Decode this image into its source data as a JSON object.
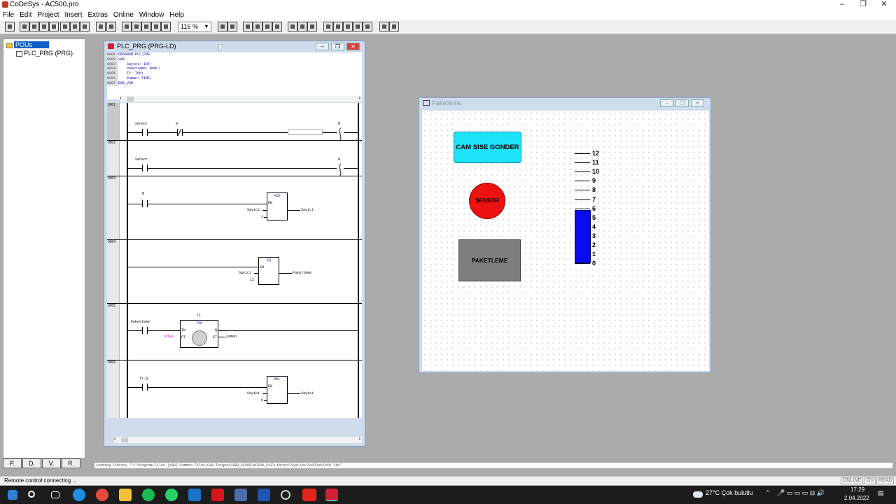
{
  "app": {
    "title": "CoDeSys - AC500.pro",
    "window_controls": [
      "–",
      "❐",
      "✕"
    ]
  },
  "menu": [
    "File",
    "Edit",
    "Project",
    "Insert",
    "Extras",
    "Online",
    "Window",
    "Help"
  ],
  "toolbar": {
    "zoom": "116 %"
  },
  "tree": {
    "root": "POUs",
    "child": "PLC_PRG (PRG)"
  },
  "left_tabs": [
    "P.",
    "D.",
    "V.",
    "R."
  ],
  "editor": {
    "title": "PLC_PRG (PRG-LD)",
    "declaration": [
      {
        "ln": "0001",
        "text": "PROGRAM PLC_PRG"
      },
      {
        "ln": "0002",
        "text": "VAR"
      },
      {
        "ln": "0003",
        "text": "    Sayici: INT;"
      },
      {
        "ln": "0004",
        "text": "    Paketleme: BOOL;"
      },
      {
        "ln": "0005",
        "text": "    T1: TON;"
      },
      {
        "ln": "0006",
        "text": "    Zaman: TIME;"
      },
      {
        "ln": "0007",
        "text": "END_VAR"
      }
    ],
    "rungs": {
      "r1": {
        "num": "0001",
        "c1": "Sensor",
        "c2": "N",
        "coil": "M"
      },
      "r2": {
        "num": "0002",
        "c1": "Sensor",
        "coil": "N"
      },
      "r3": {
        "num": "0003",
        "c1": "M",
        "fb": "ADD",
        "en": "EN",
        "in1": "Sayici",
        "in2": "1",
        "out": "Sayici"
      },
      "r4": {
        "num": "0004",
        "fb": "EQ",
        "en": "EN",
        "in1": "Sayici",
        "in2": "12",
        "out": "Paketleme"
      },
      "r5": {
        "num": "0005",
        "c1": "Paketleme",
        "inst": "T1",
        "fb": "TON",
        "in": "IN",
        "pt": "PT",
        "q": "Q",
        "et": "ET",
        "pt_val": "T#10s",
        "out": "Zaman"
      },
      "r6": {
        "num": "0006",
        "c1": "T1.Q",
        "fb": "MUL",
        "en": "EN",
        "in1": "Sayici",
        "in2": "0",
        "out": "Sayici"
      }
    }
  },
  "visu": {
    "title": "Paketleme",
    "button_cam": "CAM SISE GONDER",
    "sensor": "SENSOR",
    "paket": "PAKETLEME",
    "scale": [
      "12",
      "11",
      "10",
      "9",
      "8",
      "7",
      "6",
      "5",
      "4",
      "3",
      "2",
      "1",
      "0"
    ],
    "level": 5.8,
    "colors": {
      "button": "#1fe1f8",
      "sensor": "#ee1111",
      "bar": "#0b0bf0",
      "paket": "#7d7d7d"
    }
  },
  "message": "Loading library 'C:\\Program Files (x86)\\Common Files\\CAA-Targets\\ABB_AC500\\AC500_V12\\Library\\SysLibs\\SysTaskInfo.lib'",
  "status": {
    "text": "Remote control connecting ...",
    "indicators": [
      "ONLINE",
      "OV",
      "READ"
    ]
  },
  "taskbar": {
    "weather": "27°C  Çok bulutlu",
    "time": "17:29",
    "date": "2.04.2022"
  }
}
